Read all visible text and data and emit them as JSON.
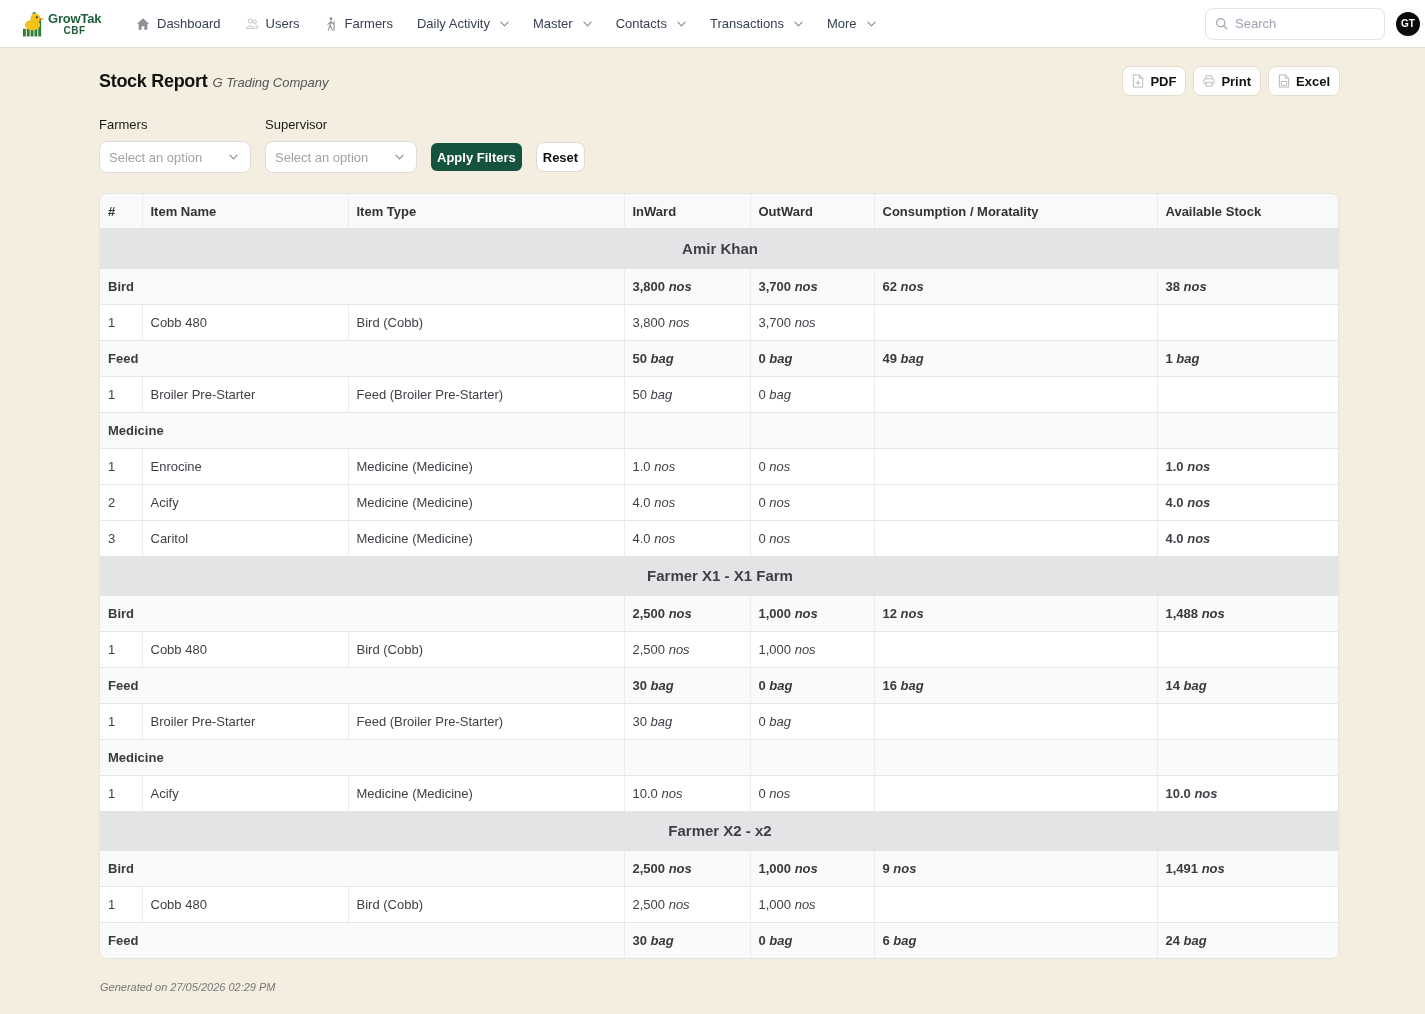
{
  "nav": {
    "logo": {
      "title": "GrowTak",
      "subtitle": "CBF"
    },
    "items": [
      {
        "label": "Dashboard",
        "kind": "link"
      },
      {
        "label": "Users",
        "kind": "link"
      },
      {
        "label": "Farmers",
        "kind": "link"
      },
      {
        "label": "Daily Activity",
        "kind": "menu"
      },
      {
        "label": "Master",
        "kind": "menu"
      },
      {
        "label": "Contacts",
        "kind": "menu"
      },
      {
        "label": "Transactions",
        "kind": "menu"
      },
      {
        "label": "More",
        "kind": "menu"
      }
    ],
    "search": {
      "placeholder": "Search"
    },
    "avatar": "GT"
  },
  "header": {
    "title": "Stock Report",
    "subtitle": "G Trading Company",
    "actions": [
      "PDF",
      "Print",
      "Excel"
    ]
  },
  "filters": [
    {
      "label": "Farmers",
      "placeholder": "Select an option"
    },
    {
      "label": "Supervisor",
      "placeholder": "Select an option"
    }
  ],
  "filter_buttons": [
    {
      "label": "Apply Filters",
      "kind": "primary"
    },
    {
      "label": "Reset",
      "kind": "secondary"
    }
  ],
  "table": {
    "columns": [
      "#",
      "Item Name",
      "Item Type",
      "InWard",
      "OutWard",
      "Consumption / Moratality",
      "Available Stock"
    ],
    "groups": [
      {
        "name": "Amir Khan",
        "categories": [
          {
            "name": "Bird",
            "inward": "3,800 *nos*",
            "outward": "3,700 *nos*",
            "consumption": "62 *nos*",
            "available": "38 *nos*",
            "items": [
              {
                "number": "1",
                "name": "Cobb 480",
                "type": "Bird (Cobb)",
                "inward": "3,800 *nos*",
                "outward": "3,700 *nos*"
              }
            ]
          },
          {
            "name": "Feed",
            "inward": "50 *bag*",
            "outward": "0 *bag*",
            "consumption": "49 *bag*",
            "available": "1 *bag*",
            "items": [
              {
                "number": "1",
                "name": "Broiler Pre-Starter",
                "type": "Feed (Broiler Pre-Starter)",
                "inward": "50 *bag*",
                "outward": "0 *bag*"
              }
            ]
          },
          {
            "name": "Medicine",
            "items": [
              {
                "number": "1",
                "name": "Enrocine",
                "type": "Medicine (Medicine)",
                "inward": "1.0 *nos*",
                "outward": "0 *nos*",
                "available": "1.0 *nos*"
              },
              {
                "number": "2",
                "name": "Acify",
                "type": "Medicine (Medicine)",
                "inward": "4.0 *nos*",
                "outward": "0 *nos*",
                "available": "4.0 *nos*"
              },
              {
                "number": "3",
                "name": "Caritol",
                "type": "Medicine (Medicine)",
                "inward": "4.0 *nos*",
                "outward": "0 *nos*",
                "available": "4.0 *nos*"
              }
            ]
          }
        ]
      },
      {
        "name": "Farmer X1 - X1 Farm",
        "categories": [
          {
            "name": "Bird",
            "inward": "2,500 *nos*",
            "outward": "1,000 *nos*",
            "consumption": "12 *nos*",
            "available": "1,488 *nos*",
            "items": [
              {
                "number": "1",
                "name": "Cobb 480",
                "type": "Bird (Cobb)",
                "inward": "2,500 *nos*",
                "outward": "1,000 *nos*"
              }
            ]
          },
          {
            "name": "Feed",
            "inward": "30 *bag*",
            "outward": "0 *bag*",
            "consumption": "16 *bag*",
            "available": "14 *bag*",
            "items": [
              {
                "number": "1",
                "name": "Broiler Pre-Starter",
                "type": "Feed (Broiler Pre-Starter)",
                "inward": "30 *bag*",
                "outward": "0 *bag*"
              }
            ]
          },
          {
            "name": "Medicine",
            "items": [
              {
                "number": "1",
                "name": "Acify",
                "type": "Medicine (Medicine)",
                "inward": "10.0 *nos*",
                "outward": "0 *nos*",
                "available": "10.0 *nos*"
              }
            ]
          }
        ]
      },
      {
        "name": "Farmer X2 - x2",
        "categories": [
          {
            "name": "Bird",
            "inward": "2,500 *nos*",
            "outward": "1,000 *nos*",
            "consumption": "9 *nos*",
            "available": "1,491 *nos*",
            "items": [
              {
                "number": "1",
                "name": "Cobb 480",
                "type": "Bird (Cobb)",
                "inward": "2,500 *nos*",
                "outward": "1,000 *nos*"
              }
            ]
          },
          {
            "name": "Feed",
            "inward": "30 *bag*",
            "outward": "0 *bag*",
            "consumption": "6 *bag*",
            "available": "24 *bag*"
          }
        ]
      }
    ]
  },
  "footer": "Generated on 27/05/2026 02:29 PM"
}
